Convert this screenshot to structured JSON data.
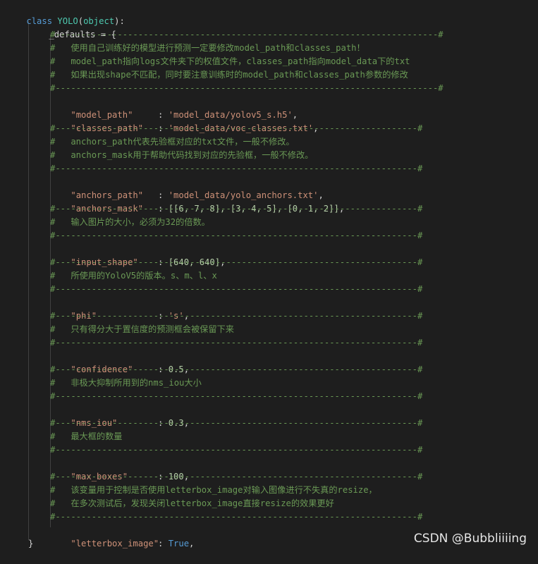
{
  "code": {
    "class_decl": {
      "kw": "class",
      "name": "YOLO",
      "open": "(",
      "base": "object",
      "close": "):"
    },
    "defaults_line": "_defaults = {",
    "closing_brace": "}",
    "rule_long": "#--------------------------------------------------------------------------#",
    "rule_short": "#----------------------------------------------------------------------#",
    "comments": {
      "c1": "#   使用自己训练好的模型进行预测一定要修改model_path和classes_path！",
      "c2": "#   model_path指向logs文件夹下的权值文件，classes_path指向model_data下的txt",
      "c3": "#   如果出现shape不匹配，同时要注意训练时的model_path和classes_path参数的修改",
      "c4": "#   anchors_path代表先验框对应的txt文件，一般不修改。",
      "c5": "#   anchors_mask用于帮助代码找到对应的先验框，一般不修改。",
      "c6": "#   输入图片的大小，必须为32的倍数。",
      "c7": "#   所使用的YoloV5的版本。s、m、l、x",
      "c8": "#   只有得分大于置信度的预测框会被保留下来",
      "c9": "#   非极大抑制所用到的nms_iou大小",
      "c10": "#   最大框的数量",
      "c11": "#   该变量用于控制是否使用letterbox_image对输入图像进行不失真的resize，",
      "c12": "#   在多次测试后，发现关闭letterbox_image直接resize的效果更好"
    },
    "entries": {
      "model_path": {
        "key": "\"model_path\"",
        "sep": ": ",
        "val": "'model_data/yolov5_s.h5'",
        "end": ","
      },
      "classes_path": {
        "key": "\"classes_path\"",
        "sep": ": ",
        "val": "'model_data/voc_classes.txt'",
        "end": ","
      },
      "anchors_path": {
        "key": "\"anchors_path\"",
        "sep": ": ",
        "val": "'model_data/yolo_anchors.txt'",
        "end": ","
      },
      "anchors_mask": {
        "key": "\"anchors_mask\"",
        "sep": ": ",
        "val": "[[6, 7, 8], [3, 4, 5], [0, 1, 2]]",
        "end": ","
      },
      "input_shape": {
        "key": "\"input_shape\"",
        "sep": ": ",
        "val": "[640, 640]",
        "end": ","
      },
      "phi": {
        "key": "\"phi\"",
        "sep": ": ",
        "val": "'s'",
        "end": ","
      },
      "confidence": {
        "key": "\"confidence\"",
        "sep": ": ",
        "val": "0.5",
        "end": ","
      },
      "nms_iou": {
        "key": "\"nms_iou\"",
        "sep": ": ",
        "val": "0.3",
        "end": ","
      },
      "max_boxes": {
        "key": "\"max_boxes\"",
        "sep": ": ",
        "val": "100",
        "end": ","
      },
      "letterbox_image": {
        "key": "\"letterbox_image\"",
        "sep": ": ",
        "val": "True",
        "end": ","
      }
    }
  },
  "watermark": "CSDN @Bubbliiiing",
  "colors": {
    "background": "#1e1e1e",
    "keyword": "#569cd6",
    "class_name": "#4ec9b0",
    "comment": "#6a9955",
    "string": "#ce9178",
    "number": "#b5cea8",
    "text": "#d4d4d4"
  }
}
